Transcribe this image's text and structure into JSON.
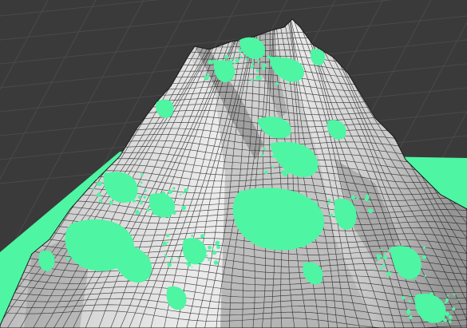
{
  "viewport": {
    "kind": "3d-viewport",
    "render_mode": "shaded-wireframe",
    "colors": {
      "background": "#3a3a3a",
      "grid_line": "#4a4a4a",
      "ground_plane": "#4ef5a3",
      "surface_light": "#ececec",
      "surface_mid": "#bcbcbc",
      "surface_dark": "#6f6f6f",
      "wire": "#1a1a1a",
      "vegetation": "#4ef5a3"
    },
    "object": {
      "name_icon": "terrain-mesh-icon",
      "selected": false
    }
  }
}
